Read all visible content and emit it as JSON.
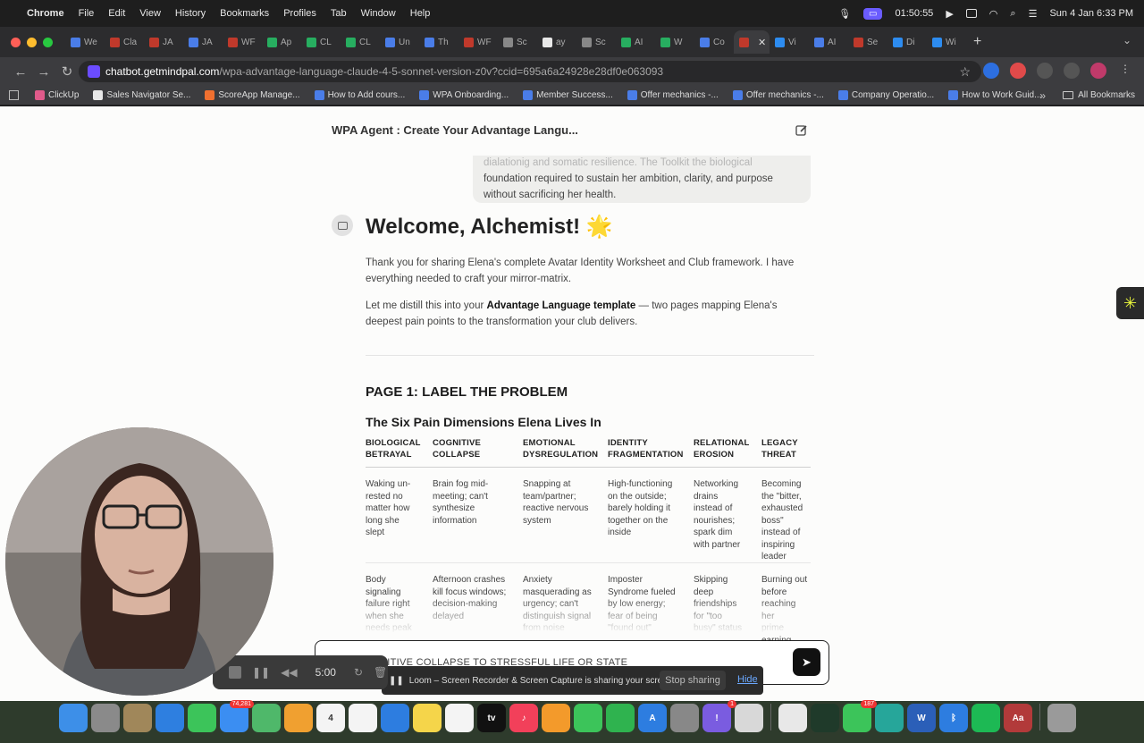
{
  "menubar": {
    "app": "Chrome",
    "items": [
      "File",
      "Edit",
      "View",
      "History",
      "Bookmarks",
      "Profiles",
      "Tab",
      "Window",
      "Help"
    ],
    "recording_time": "01:50:55",
    "datetime": "Sun 4 Jan  6:33 PM"
  },
  "tabs": [
    {
      "label": "We",
      "color": "#4a7de8"
    },
    {
      "label": "Cla",
      "color": "#c0392b"
    },
    {
      "label": "JA",
      "color": "#c0392b"
    },
    {
      "label": "JA",
      "color": "#4a7de8"
    },
    {
      "label": "WF",
      "color": "#c0392b"
    },
    {
      "label": "Ap",
      "color": "#27ae60"
    },
    {
      "label": "CL",
      "color": "#27ae60"
    },
    {
      "label": "CL",
      "color": "#27ae60"
    },
    {
      "label": "Un",
      "color": "#4a7de8"
    },
    {
      "label": "Th",
      "color": "#4a7de8"
    },
    {
      "label": "WF",
      "color": "#c0392b"
    },
    {
      "label": "Sc",
      "color": "#888888"
    },
    {
      "label": "ay",
      "color": "#e8e8e8"
    },
    {
      "label": "Sc",
      "color": "#888888"
    },
    {
      "label": "AI",
      "color": "#27ae60"
    },
    {
      "label": "W",
      "color": "#27ae60"
    },
    {
      "label": "Co",
      "color": "#4a7de8"
    },
    {
      "label": "",
      "color": "#c0392b",
      "active": true
    },
    {
      "label": "Vi",
      "color": "#2d8cf0"
    },
    {
      "label": "AI",
      "color": "#4a7de8"
    },
    {
      "label": "Se",
      "color": "#c0392b"
    },
    {
      "label": "Di",
      "color": "#2d8cf0"
    },
    {
      "label": "Wi",
      "color": "#2d8cf0"
    }
  ],
  "address": {
    "host": "chatbot.getmindpal.com",
    "path": "/wpa-advantage-language-claude-4-5-sonnet-version-z0v?ccid=695a6a24928e28df0e063093"
  },
  "bookmarks": [
    "ClickUp",
    "Sales Navigator Se...",
    "ScoreApp Manage...",
    "How to Add cours...",
    "WPA Onboarding...",
    "Member Success...",
    "Offer mechanics -...",
    "Offer mechanics -...",
    "Company Operatio...",
    "How to Work Guid..."
  ],
  "bookmarks_all": "All Bookmarks",
  "chat": {
    "title": "WPA Agent : Create Your Advantage Langu...",
    "user_faded": "dialationig and somatic resilience. The Toolkit the biological",
    "user_line2": "foundation required to sustain her ambition, clarity, and purpose",
    "user_line3": "without sacrificing her health.",
    "welcome": "Welcome, Alchemist!",
    "welcome_emoji": "🌟",
    "para1": "Thank you for sharing Elena's complete Avatar Identity Worksheet and Club framework. I have everything needed to craft your mirror-matrix.",
    "para2_prefix": "Let me distill this into your ",
    "para2_bold": "Advantage Language template",
    "para2_suffix": " — two pages mapping Elena's deepest pain points to the transformation your club delivers.",
    "page1_heading": "PAGE 1: LABEL THE PROBLEM",
    "six_heading": "The Six Pain Dimensions Elena Lives In",
    "composer_text": "NITIVE COLLAPSE TO STRESSFUL LIFE OR STATE"
  },
  "table": {
    "headers": [
      [
        "BIOLOGICAL",
        "BETRAYAL"
      ],
      [
        "COGNITIVE",
        "COLLAPSE"
      ],
      [
        "EMOTIONAL",
        "DYSREGULATION"
      ],
      [
        "IDENTITY",
        "FRAGMENTATION"
      ],
      [
        "RELATIONAL",
        "EROSION"
      ],
      [
        "LEGACY",
        "THREAT"
      ]
    ],
    "row1": [
      [
        "Waking un-",
        "rested no",
        "matter how",
        "long she",
        "slept"
      ],
      [
        "Brain fog mid-",
        "meeting; can't",
        "synthesize",
        "information"
      ],
      [
        "Snapping at",
        "team/partner;",
        "reactive nervous",
        "system"
      ],
      [
        "High-functioning",
        "on the outside;",
        "barely holding it",
        "together on the",
        "inside"
      ],
      [
        "Networking",
        "drains",
        "instead of",
        "nourishes;",
        "spark dim",
        "with partner"
      ],
      [
        "Becoming",
        "the \"bitter,",
        "exhausted",
        "boss\"",
        "instead of",
        "inspiring",
        "leader"
      ]
    ],
    "row2": [
      [
        "Body",
        "signaling",
        "failure right",
        "when she",
        "needs peak"
      ],
      [
        "Afternoon crashes",
        "kill focus windows;",
        "decision-making",
        "delayed"
      ],
      [
        "Anxiety",
        "masquerading as",
        "urgency; can't",
        "distinguish signal",
        "from noise"
      ],
      [
        "Imposter",
        "Syndrome fueled",
        "by low energy;",
        "fear of being",
        "\"found out\""
      ],
      [
        "Skipping",
        "deep",
        "friendships",
        "for \"too",
        "busy\" status"
      ],
      [
        "Burning out",
        "before",
        "reaching her",
        "prime",
        "earning"
      ]
    ]
  },
  "loom": {
    "message": "Loom – Screen Recorder & Screen Capture is sharing your screen.",
    "stop_label": "Stop sharing",
    "hide_label": "Hide",
    "timer": "5:00"
  },
  "dock": [
    {
      "name": "finder",
      "color": "#3d8fe8",
      "label": ""
    },
    {
      "name": "launchpad",
      "color": "#8a8a8a",
      "label": ""
    },
    {
      "name": "notes-app",
      "color": "#a0875a",
      "label": ""
    },
    {
      "name": "safari",
      "color": "#2e7fe0",
      "label": ""
    },
    {
      "name": "messages",
      "color": "#3cc45a",
      "label": ""
    },
    {
      "name": "mail",
      "color": "#3b8ef2",
      "label": "",
      "badge": "74,281"
    },
    {
      "name": "maps",
      "color": "#4fb86a",
      "label": ""
    },
    {
      "name": "photos",
      "color": "#f0a030",
      "label": ""
    },
    {
      "name": "calendar",
      "color": "#f4f4f4",
      "label": "4"
    },
    {
      "name": "reminders",
      "color": "#f4f4f4",
      "label": ""
    },
    {
      "name": "keynote",
      "color": "#2d7de0",
      "label": ""
    },
    {
      "name": "notes",
      "color": "#f5d54a",
      "label": ""
    },
    {
      "name": "freeform",
      "color": "#f4f4f4",
      "label": ""
    },
    {
      "name": "apple-tv",
      "color": "#111111",
      "label": "tv"
    },
    {
      "name": "music",
      "color": "#f2405a",
      "label": "♪"
    },
    {
      "name": "pages",
      "color": "#f39a2b",
      "label": ""
    },
    {
      "name": "facetime",
      "color": "#3cc45a",
      "label": ""
    },
    {
      "name": "numbers",
      "color": "#2fb34f",
      "label": ""
    },
    {
      "name": "app-store",
      "color": "#2d7de0",
      "label": "A"
    },
    {
      "name": "system-settings",
      "color": "#888888",
      "label": ""
    },
    {
      "name": "feedback",
      "color": "#7a5ce0",
      "label": "!",
      "badge": "1"
    },
    {
      "name": "script-editor",
      "color": "#d8d8d8",
      "label": ""
    },
    {
      "name": "chrome",
      "color": "#e8e8e8",
      "label": ""
    },
    {
      "name": "activity-monitor",
      "color": "#1f3a2a",
      "label": ""
    },
    {
      "name": "whatsapp",
      "color": "#3cc45a",
      "label": "",
      "badge": "187"
    },
    {
      "name": "loom-app",
      "color": "#26a69a",
      "label": ""
    },
    {
      "name": "word",
      "color": "#2b5fb8",
      "label": "W"
    },
    {
      "name": "bluetooth",
      "color": "#2d7de0",
      "label": "ᛒ"
    },
    {
      "name": "spotify",
      "color": "#1db954",
      "label": ""
    },
    {
      "name": "dictionary",
      "color": "#b23a3a",
      "label": "Aa"
    },
    {
      "name": "trash",
      "color": "#9a9a9a",
      "label": ""
    }
  ]
}
